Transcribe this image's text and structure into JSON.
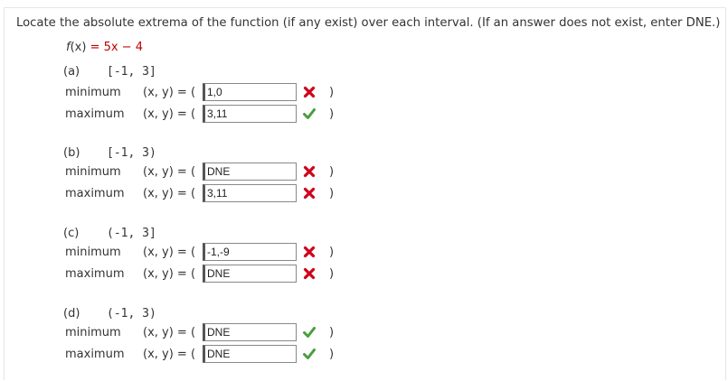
{
  "question": "Locate the absolute extrema of the function (if any exist) over each interval. (If an answer does not exist, enter DNE.)",
  "function": {
    "lhs": "f",
    "arg": "(x)",
    "eq": " = 5x − 4"
  },
  "parts": [
    {
      "label": "(a)",
      "interval": "[-1, 3]",
      "rows": [
        {
          "label": "minimum",
          "prefix": "(x, y) = (",
          "value": "1,0",
          "status": "incorrect",
          "suffix": ")"
        },
        {
          "label": "maximum",
          "prefix": "(x, y) = (",
          "value": "3,11",
          "status": "correct",
          "suffix": ")"
        }
      ]
    },
    {
      "label": "(b)",
      "interval": "[-1, 3)",
      "rows": [
        {
          "label": "minimum",
          "prefix": "(x, y) = (",
          "value": "DNE",
          "status": "incorrect",
          "suffix": ")"
        },
        {
          "label": "maximum",
          "prefix": "(x, y) = (",
          "value": "3,11",
          "status": "incorrect",
          "suffix": ")"
        }
      ]
    },
    {
      "label": "(c)",
      "interval": "(-1, 3]",
      "rows": [
        {
          "label": "minimum",
          "prefix": "(x, y) = (",
          "value": "-1,-9",
          "status": "incorrect",
          "suffix": ")"
        },
        {
          "label": "maximum",
          "prefix": "(x, y) = (",
          "value": "DNE",
          "status": "incorrect",
          "suffix": ")"
        }
      ]
    },
    {
      "label": "(d)",
      "interval": "(-1, 3)",
      "rows": [
        {
          "label": "minimum",
          "prefix": "(x, y) = (",
          "value": "DNE",
          "status": "correct",
          "suffix": ")"
        },
        {
          "label": "maximum",
          "prefix": "(x, y) = (",
          "value": "DNE",
          "status": "correct",
          "suffix": ")"
        }
      ]
    }
  ],
  "colors": {
    "correct": "#4a9d3f",
    "incorrect": "#d0021b",
    "function_eq": "#c00000"
  },
  "icons": {
    "correct": "check-icon",
    "incorrect": "x-icon"
  }
}
